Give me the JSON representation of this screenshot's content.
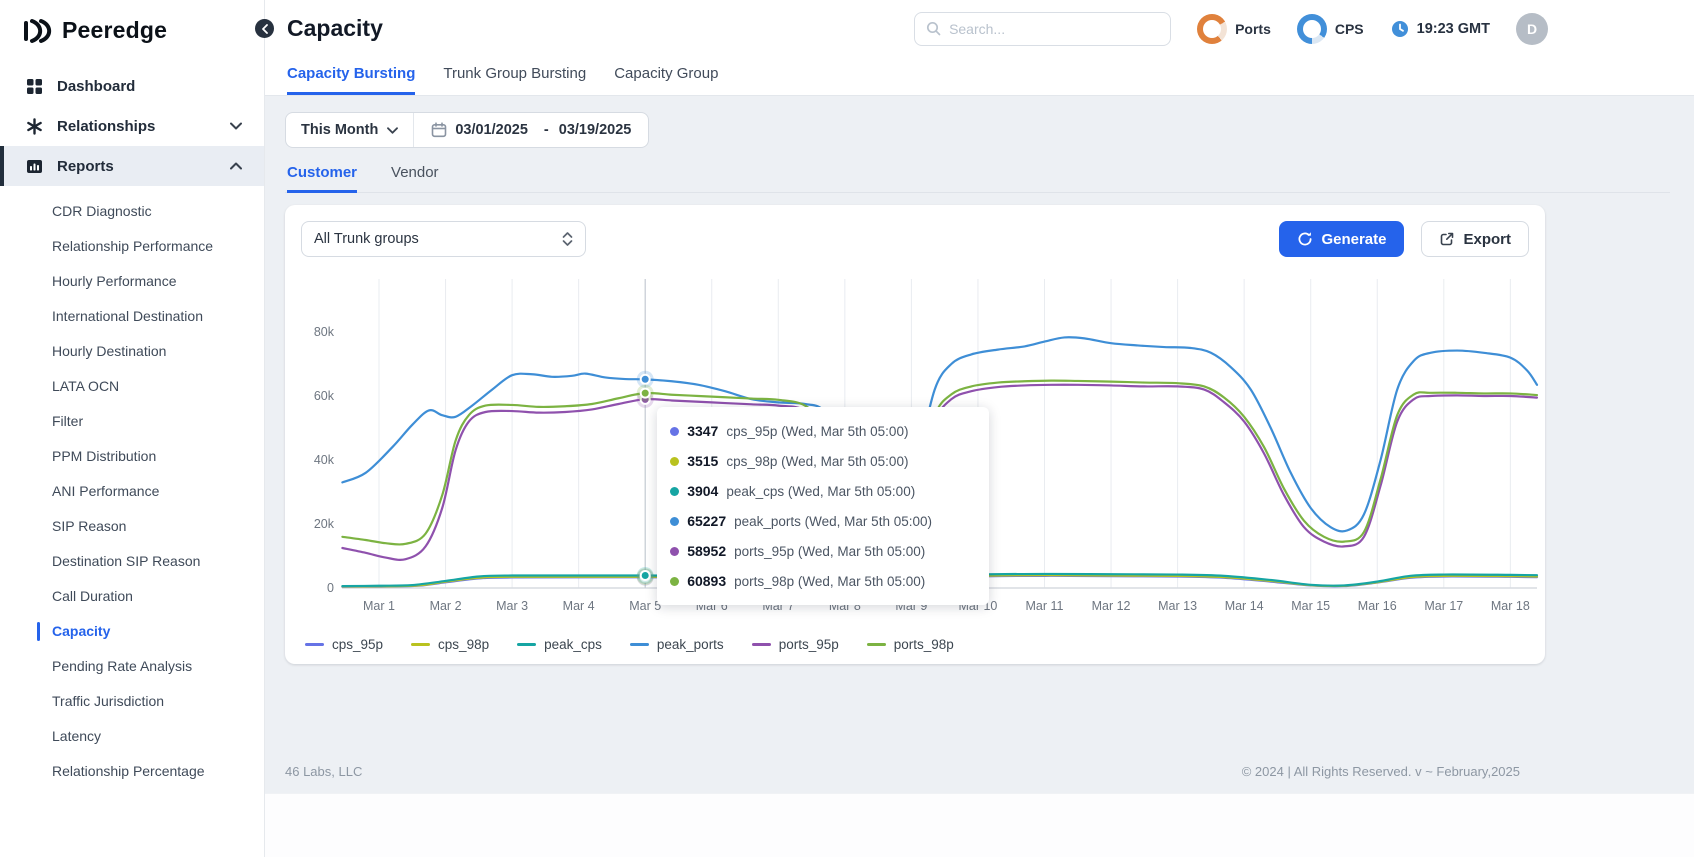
{
  "brand": {
    "name": "Peeredge"
  },
  "sidebar": {
    "items": [
      {
        "label": "Dashboard",
        "icon": "dashboard-icon"
      },
      {
        "label": "Relationships",
        "icon": "relationships-icon",
        "chevron": "down"
      },
      {
        "label": "Reports",
        "icon": "reports-icon",
        "chevron": "up",
        "active": true
      }
    ],
    "report_items": [
      "CDR Diagnostic",
      "Relationship Performance",
      "Hourly Performance",
      "International Destination",
      "Hourly Destination",
      "LATA OCN",
      "Filter",
      "PPM Distribution",
      "ANI Performance",
      "SIP Reason",
      "Destination SIP Reason",
      "Call Duration",
      "Capacity",
      "Pending Rate Analysis",
      "Traffic Jurisdiction",
      "Latency",
      "Relationship Percentage"
    ],
    "active_report_item": "Capacity"
  },
  "header": {
    "title": "Capacity",
    "search_placeholder": "Search...",
    "gauges": [
      {
        "label": "Ports",
        "color": "#e0813c"
      },
      {
        "label": "CPS",
        "color": "#418fd9"
      }
    ],
    "time": "19:23 GMT",
    "avatar_initial": "D"
  },
  "tabs": [
    "Capacity Bursting",
    "Trunk Group Bursting",
    "Capacity Group"
  ],
  "active_tab": "Capacity Bursting",
  "filters": {
    "period": "This Month",
    "date_from": "03/01/2025",
    "date_separator": "-",
    "date_to": "03/19/2025"
  },
  "subtabs": [
    "Customer",
    "Vendor"
  ],
  "active_subtab": "Customer",
  "panel": {
    "trunk_select": "All Trunk groups",
    "generate_label": "Generate",
    "export_label": "Export"
  },
  "chart_data": {
    "type": "line",
    "title": "",
    "xlabel": "",
    "ylabel": "",
    "value_unit": "thousands (k)",
    "ylim": [
      0,
      88
    ],
    "grid": "vertical",
    "legend_position": "bottom",
    "y_ticks": [
      "0",
      "20k",
      "40k",
      "60k",
      "80k"
    ],
    "x_ticks": [
      "Mar 1",
      "Mar 2",
      "Mar 3",
      "Mar 4",
      "Mar 5",
      "Mar 6",
      "Mar 7",
      "Mar 8",
      "Mar 9",
      "Mar 10",
      "Mar 11",
      "Mar 12",
      "Mar 13",
      "Mar 14",
      "Mar 15",
      "Mar 16",
      "Mar 17",
      "Mar 18"
    ],
    "series": [
      {
        "name": "cps_95p",
        "color": "#6673e6",
        "points": [
          [
            0.45,
            0.4
          ],
          [
            1.5,
            0.6
          ],
          [
            2.0,
            1.8
          ],
          [
            2.5,
            3.0
          ],
          [
            3.0,
            3.3
          ],
          [
            5.0,
            3.35
          ],
          [
            7.0,
            3.2
          ],
          [
            7.7,
            2.5
          ],
          [
            8.3,
            0.9
          ],
          [
            8.7,
            0.6
          ],
          [
            9.2,
            1.6
          ],
          [
            9.6,
            3.0
          ],
          [
            10.0,
            3.6
          ],
          [
            11.0,
            3.8
          ],
          [
            12.0,
            3.7
          ],
          [
            13.0,
            3.6
          ],
          [
            13.7,
            3.2
          ],
          [
            14.4,
            2.0
          ],
          [
            15.0,
            0.8
          ],
          [
            15.5,
            0.6
          ],
          [
            16.0,
            1.7
          ],
          [
            16.5,
            3.2
          ],
          [
            17.0,
            3.6
          ],
          [
            18.0,
            3.5
          ],
          [
            18.4,
            3.4
          ]
        ]
      },
      {
        "name": "cps_98p",
        "color": "#b9c21f",
        "points": [
          [
            0.45,
            0.5
          ],
          [
            1.5,
            0.7
          ],
          [
            2.0,
            2.0
          ],
          [
            2.5,
            3.2
          ],
          [
            3.0,
            3.5
          ],
          [
            5.0,
            3.5
          ],
          [
            7.0,
            3.4
          ],
          [
            7.7,
            2.7
          ],
          [
            8.3,
            1.0
          ],
          [
            8.7,
            0.7
          ],
          [
            9.2,
            1.8
          ],
          [
            9.6,
            3.2
          ],
          [
            10.0,
            3.8
          ],
          [
            11.0,
            4.0
          ],
          [
            12.0,
            3.9
          ],
          [
            13.0,
            3.8
          ],
          [
            13.7,
            3.4
          ],
          [
            14.4,
            2.2
          ],
          [
            15.0,
            0.9
          ],
          [
            15.5,
            0.7
          ],
          [
            16.0,
            1.8
          ],
          [
            16.5,
            3.4
          ],
          [
            17.0,
            3.8
          ],
          [
            18.0,
            3.7
          ],
          [
            18.4,
            3.6
          ]
        ]
      },
      {
        "name": "peak_cps",
        "color": "#16a5a3",
        "points": [
          [
            0.45,
            0.6
          ],
          [
            1.0,
            0.7
          ],
          [
            1.5,
            0.9
          ],
          [
            2.0,
            2.2
          ],
          [
            2.5,
            3.6
          ],
          [
            3.0,
            3.9
          ],
          [
            4.0,
            3.9
          ],
          [
            5.0,
            3.9
          ],
          [
            6.0,
            3.8
          ],
          [
            7.0,
            3.7
          ],
          [
            7.7,
            3.0
          ],
          [
            8.3,
            1.2
          ],
          [
            8.7,
            0.8
          ],
          [
            9.2,
            2.0
          ],
          [
            9.6,
            3.6
          ],
          [
            10.0,
            4.2
          ],
          [
            11.0,
            4.4
          ],
          [
            12.0,
            4.3
          ],
          [
            13.0,
            4.2
          ],
          [
            13.7,
            3.8
          ],
          [
            14.4,
            2.5
          ],
          [
            15.0,
            1.0
          ],
          [
            15.5,
            0.8
          ],
          [
            16.0,
            2.0
          ],
          [
            16.5,
            3.8
          ],
          [
            17.0,
            4.2
          ],
          [
            18.0,
            4.1
          ],
          [
            18.4,
            4.0
          ]
        ]
      },
      {
        "name": "peak_ports",
        "color": "#3e8ed6",
        "points": [
          [
            0.45,
            33
          ],
          [
            0.8,
            36
          ],
          [
            1.2,
            44
          ],
          [
            1.5,
            51
          ],
          [
            1.75,
            55.5
          ],
          [
            1.95,
            54
          ],
          [
            2.15,
            53.5
          ],
          [
            2.4,
            57
          ],
          [
            2.7,
            62
          ],
          [
            3.0,
            66.5
          ],
          [
            3.3,
            66.8
          ],
          [
            3.6,
            66
          ],
          [
            3.9,
            66.3
          ],
          [
            4.1,
            67
          ],
          [
            4.4,
            65.8
          ],
          [
            4.7,
            65.3
          ],
          [
            5.0,
            65.2
          ],
          [
            5.4,
            64.6
          ],
          [
            5.8,
            63.5
          ],
          [
            6.2,
            61.5
          ],
          [
            6.6,
            59
          ],
          [
            7.0,
            58
          ],
          [
            7.4,
            57.5
          ],
          [
            7.7,
            55
          ],
          [
            8.0,
            42
          ],
          [
            8.3,
            24
          ],
          [
            8.6,
            17
          ],
          [
            8.9,
            20
          ],
          [
            9.1,
            40
          ],
          [
            9.35,
            62
          ],
          [
            9.6,
            70
          ],
          [
            9.9,
            73
          ],
          [
            10.3,
            74.5
          ],
          [
            10.7,
            75.5
          ],
          [
            11.0,
            77
          ],
          [
            11.3,
            78.3
          ],
          [
            11.6,
            78
          ],
          [
            12.0,
            76.5
          ],
          [
            12.4,
            75.8
          ],
          [
            12.8,
            75.3
          ],
          [
            13.2,
            75
          ],
          [
            13.5,
            73.5
          ],
          [
            13.8,
            69
          ],
          [
            14.1,
            62
          ],
          [
            14.4,
            50
          ],
          [
            14.7,
            36
          ],
          [
            15.0,
            25
          ],
          [
            15.3,
            19
          ],
          [
            15.55,
            18
          ],
          [
            15.8,
            23
          ],
          [
            16.05,
            40
          ],
          [
            16.3,
            62
          ],
          [
            16.55,
            71
          ],
          [
            16.8,
            73.5
          ],
          [
            17.2,
            74.2
          ],
          [
            17.6,
            73.5
          ],
          [
            18.0,
            72
          ],
          [
            18.25,
            68
          ],
          [
            18.4,
            63.5
          ]
        ]
      },
      {
        "name": "ports_95p",
        "color": "#8f51ad",
        "points": [
          [
            0.45,
            12.5
          ],
          [
            0.8,
            11
          ],
          [
            1.1,
            9.5
          ],
          [
            1.4,
            9
          ],
          [
            1.7,
            13
          ],
          [
            1.95,
            25
          ],
          [
            2.15,
            43
          ],
          [
            2.35,
            52
          ],
          [
            2.6,
            55
          ],
          [
            3.0,
            55.3
          ],
          [
            3.4,
            54.8
          ],
          [
            3.8,
            55
          ],
          [
            4.2,
            55.8
          ],
          [
            4.6,
            57.5
          ],
          [
            5.0,
            59
          ],
          [
            5.4,
            58.6
          ],
          [
            5.8,
            58.2
          ],
          [
            6.2,
            57.8
          ],
          [
            6.6,
            57.4
          ],
          [
            7.0,
            57
          ],
          [
            7.4,
            55.5
          ],
          [
            7.7,
            48
          ],
          [
            8.0,
            30
          ],
          [
            8.3,
            17
          ],
          [
            8.6,
            13
          ],
          [
            8.9,
            16
          ],
          [
            9.1,
            33
          ],
          [
            9.35,
            52
          ],
          [
            9.6,
            59
          ],
          [
            9.9,
            61.5
          ],
          [
            10.3,
            62.8
          ],
          [
            10.7,
            63.3
          ],
          [
            11.1,
            63.5
          ],
          [
            11.5,
            63.5
          ],
          [
            12.0,
            63.3
          ],
          [
            12.5,
            63
          ],
          [
            13.0,
            63
          ],
          [
            13.4,
            62
          ],
          [
            13.7,
            58
          ],
          [
            14.0,
            52
          ],
          [
            14.3,
            42
          ],
          [
            14.6,
            29
          ],
          [
            14.9,
            19
          ],
          [
            15.2,
            14.5
          ],
          [
            15.5,
            13
          ],
          [
            15.8,
            16
          ],
          [
            16.05,
            32
          ],
          [
            16.3,
            52
          ],
          [
            16.55,
            59
          ],
          [
            16.8,
            60
          ],
          [
            17.2,
            60.2
          ],
          [
            17.6,
            60
          ],
          [
            18.0,
            60
          ],
          [
            18.4,
            59.5
          ]
        ]
      },
      {
        "name": "ports_98p",
        "color": "#7cb342",
        "points": [
          [
            0.45,
            16
          ],
          [
            0.8,
            15
          ],
          [
            1.1,
            14
          ],
          [
            1.4,
            13.8
          ],
          [
            1.7,
            17
          ],
          [
            1.95,
            29
          ],
          [
            2.15,
            46
          ],
          [
            2.35,
            54
          ],
          [
            2.6,
            57
          ],
          [
            3.0,
            57.2
          ],
          [
            3.4,
            56.6
          ],
          [
            3.8,
            56.8
          ],
          [
            4.2,
            57.5
          ],
          [
            4.6,
            59.3
          ],
          [
            5.0,
            60.9
          ],
          [
            5.4,
            60.4
          ],
          [
            5.8,
            60
          ],
          [
            6.2,
            59.6
          ],
          [
            6.6,
            59.2
          ],
          [
            7.0,
            58.8
          ],
          [
            7.4,
            57
          ],
          [
            7.7,
            50
          ],
          [
            8.0,
            32
          ],
          [
            8.3,
            19
          ],
          [
            8.6,
            15
          ],
          [
            8.9,
            18
          ],
          [
            9.1,
            35
          ],
          [
            9.35,
            54
          ],
          [
            9.6,
            60.5
          ],
          [
            9.9,
            63
          ],
          [
            10.3,
            64.2
          ],
          [
            10.7,
            64.6
          ],
          [
            11.1,
            64.8
          ],
          [
            11.5,
            64.7
          ],
          [
            12.0,
            64.5
          ],
          [
            12.5,
            64.2
          ],
          [
            13.0,
            64
          ],
          [
            13.4,
            63
          ],
          [
            13.7,
            59.5
          ],
          [
            14.0,
            53.5
          ],
          [
            14.3,
            44
          ],
          [
            14.6,
            31
          ],
          [
            14.9,
            21
          ],
          [
            15.2,
            16
          ],
          [
            15.5,
            14.5
          ],
          [
            15.8,
            17.5
          ],
          [
            16.05,
            34
          ],
          [
            16.3,
            54
          ],
          [
            16.55,
            60.5
          ],
          [
            16.8,
            61
          ],
          [
            17.2,
            61
          ],
          [
            17.6,
            60.8
          ],
          [
            18.0,
            60.8
          ],
          [
            18.4,
            60.3
          ]
        ]
      }
    ],
    "hover": {
      "day": 5.0,
      "rows": [
        {
          "value": "3347",
          "series": "cps_95p",
          "time": "Wed, Mar 5th 05:00"
        },
        {
          "value": "3515",
          "series": "cps_98p",
          "time": "Wed, Mar 5th 05:00"
        },
        {
          "value": "3904",
          "series": "peak_cps",
          "time": "Wed, Mar 5th 05:00"
        },
        {
          "value": "65227",
          "series": "peak_ports",
          "time": "Wed, Mar 5th 05:00"
        },
        {
          "value": "58952",
          "series": "ports_95p",
          "time": "Wed, Mar 5th 05:00"
        },
        {
          "value": "60893",
          "series": "ports_98p",
          "time": "Wed, Mar 5th 05:00"
        }
      ]
    }
  },
  "footer": {
    "left": "46 Labs, LLC",
    "right": "© 2024 | All Rights Reserved. v ~ February,2025"
  },
  "accent_color": "#2563eb"
}
